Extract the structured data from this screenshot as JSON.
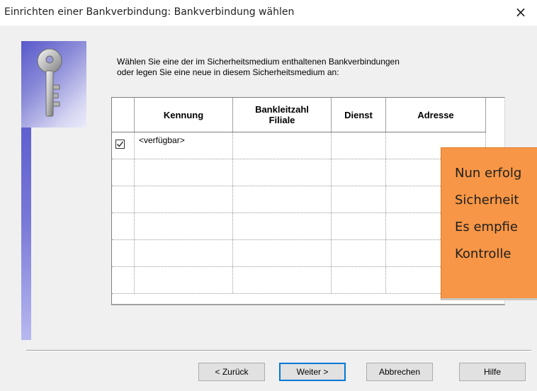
{
  "window": {
    "title": "Einrichten einer Bankverbindung: Bankverbindung wählen",
    "close_glyph": "×"
  },
  "side_graphic": {
    "icon": "key-icon",
    "colors": [
      "#4848c8",
      "#d4d4f2"
    ]
  },
  "instructions": {
    "line1": "Wählen Sie eine der im Sicherheitsmedium enthaltenen Bankverbindungen",
    "line2": "oder legen Sie eine neue in diesem Sicherheitsmedium an:"
  },
  "table": {
    "columns": [
      {
        "label": ""
      },
      {
        "label": "Kennung"
      },
      {
        "label_line1": "Bankleitzahl",
        "label_line2": "Filiale"
      },
      {
        "label": "Dienst"
      },
      {
        "label": "Adresse"
      }
    ],
    "rows": [
      {
        "checked": true,
        "kennung": "<verfügbar>",
        "blz": "",
        "dienst": "",
        "adresse": ""
      },
      {
        "checked": false,
        "kennung": "",
        "blz": "",
        "dienst": "",
        "adresse": ""
      },
      {
        "checked": false,
        "kennung": "",
        "blz": "",
        "dienst": "",
        "adresse": ""
      },
      {
        "checked": false,
        "kennung": "",
        "blz": "",
        "dienst": "",
        "adresse": ""
      },
      {
        "checked": false,
        "kennung": "",
        "blz": "",
        "dienst": "",
        "adresse": ""
      },
      {
        "checked": false,
        "kennung": "",
        "blz": "",
        "dienst": "",
        "adresse": ""
      }
    ]
  },
  "overlay_note": {
    "color": "#f79646",
    "lines": [
      "Nun erfolg",
      "Sicherheit",
      "Es empfie",
      "Kontrolle"
    ]
  },
  "buttons": {
    "back": "< Zurück",
    "next": "Weiter >",
    "cancel": "Abbrechen",
    "help": "Hilfe"
  }
}
